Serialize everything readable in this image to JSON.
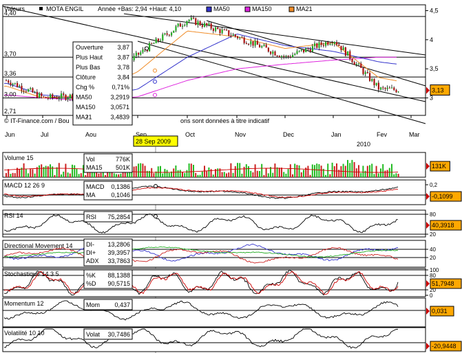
{
  "header": {
    "valeurs_label": "Valeurs",
    "stock": "MOTA ENGIL",
    "range_text": "Année +Bas: 2,94 +Haut: 4,10",
    "legend": [
      {
        "label": "MA50",
        "color": "#3333cc"
      },
      {
        "label": "MA150",
        "color": "#dd22dd"
      },
      {
        "label": "MA21",
        "color": "#f08c28"
      }
    ]
  },
  "price_axis": {
    "right_ticks": [
      "4,5",
      "4",
      "3,5",
      "3"
    ],
    "left_levels": [
      "4,40",
      "3,70",
      "3,36",
      "3,00",
      "2,71"
    ],
    "current": "3,13"
  },
  "info_box": {
    "rows": [
      {
        "label": "Ouverture",
        "value": "3,87",
        "color": "#000000"
      },
      {
        "label": "Plus Haut",
        "value": "3,87",
        "color": "#000000"
      },
      {
        "label": "Plus Bas",
        "value": "3,78",
        "color": "#000000"
      },
      {
        "label": "Clôture",
        "value": "3,84",
        "color": "#000000"
      },
      {
        "label": "Chg %",
        "value": "0,71%",
        "color": "#009900"
      },
      {
        "label": "MA50",
        "value": "3,2919",
        "color": "#3333cc"
      },
      {
        "label": "MA150",
        "value": "3,0571",
        "color": "#dd22dd"
      },
      {
        "label": "MA21",
        "value": "3,4839",
        "color": "#f08c28"
      }
    ]
  },
  "copyright": "© IT-Finance.com / Bou",
  "disclaimer": "ons sont données à titre indicatif",
  "x_months": [
    "Jun",
    "Jul",
    "Aou",
    "Sep",
    "Oct",
    "Nov",
    "Dec",
    "Jan",
    "Fev",
    "Mar"
  ],
  "x_year": "2010",
  "cursor_date": "28 Sep 2009",
  "panels": {
    "volume": {
      "title": "Volume 15",
      "box": [
        {
          "label": "Vol",
          "value": "776K"
        },
        {
          "label": "MA15",
          "value": "501K"
        }
      ],
      "right": "131K"
    },
    "macd": {
      "title": "MACD 12 26 9",
      "box": [
        {
          "label": "MACD",
          "value": "0,1386"
        },
        {
          "label": "MA",
          "value": "0,1046"
        }
      ],
      "ticks": [
        "0,2",
        "0"
      ],
      "right": "-0,1099"
    },
    "rsi": {
      "title": "RSI 14",
      "box": [
        {
          "label": "RSI",
          "value": "75,2854"
        }
      ],
      "ticks": [
        "80",
        "20"
      ],
      "right": "40,3918"
    },
    "dm": {
      "title": "Directional Movement 14",
      "box": [
        {
          "label": "DI-",
          "value": "13,2806"
        },
        {
          "label": "DI+",
          "value": "39,3957"
        },
        {
          "label": "ADX",
          "value": "33,7863"
        }
      ],
      "ticks": [
        "40",
        "20"
      ]
    },
    "stoch": {
      "title": "Stochastique 14 3 5",
      "box": [
        {
          "label": "%K",
          "value": "88,1388"
        },
        {
          "label": "%D",
          "value": "90,5715"
        }
      ],
      "ticks": [
        "100",
        "80",
        "20",
        "0"
      ],
      "right": "51,7948"
    },
    "momentum": {
      "title": "Momentum 12",
      "box": [
        {
          "label": "Mom",
          "value": "0,437"
        }
      ],
      "right": "0,031"
    },
    "volat": {
      "title": "Volatilité 10 10",
      "box": [
        {
          "label": "Volat",
          "value": "30,7486"
        }
      ],
      "right": "-20,9448"
    }
  },
  "chart_data": {
    "type": "line",
    "title": "MOTA ENGIL",
    "subtitle": "Année +Bas: 2,94 +Haut: 4,10",
    "x": [
      "Jun",
      "Jul",
      "Aou",
      "Sep",
      "Oct",
      "Nov",
      "Dec",
      "Jan",
      "Fev",
      "Mar"
    ],
    "ylim": [
      2.7,
      4.6
    ],
    "series": [
      {
        "name": "Clôture",
        "values": [
          3.3,
          3.0,
          3.05,
          3.75,
          4.35,
          4.05,
          3.7,
          4.0,
          3.15,
          3.13
        ]
      },
      {
        "name": "MA50",
        "values": [
          3.25,
          3.05,
          3.0,
          3.15,
          3.7,
          4.1,
          3.9,
          3.8,
          3.62,
          3.55
        ]
      },
      {
        "name": "MA150",
        "values": [
          3.05,
          3.0,
          2.95,
          3.02,
          3.3,
          3.5,
          3.58,
          3.65,
          3.7,
          3.7
        ]
      },
      {
        "name": "MA21",
        "values": [
          3.2,
          3.0,
          3.05,
          3.45,
          4.15,
          4.05,
          3.85,
          3.95,
          3.35,
          3.25
        ]
      }
    ],
    "grid": false,
    "legend": "top"
  }
}
